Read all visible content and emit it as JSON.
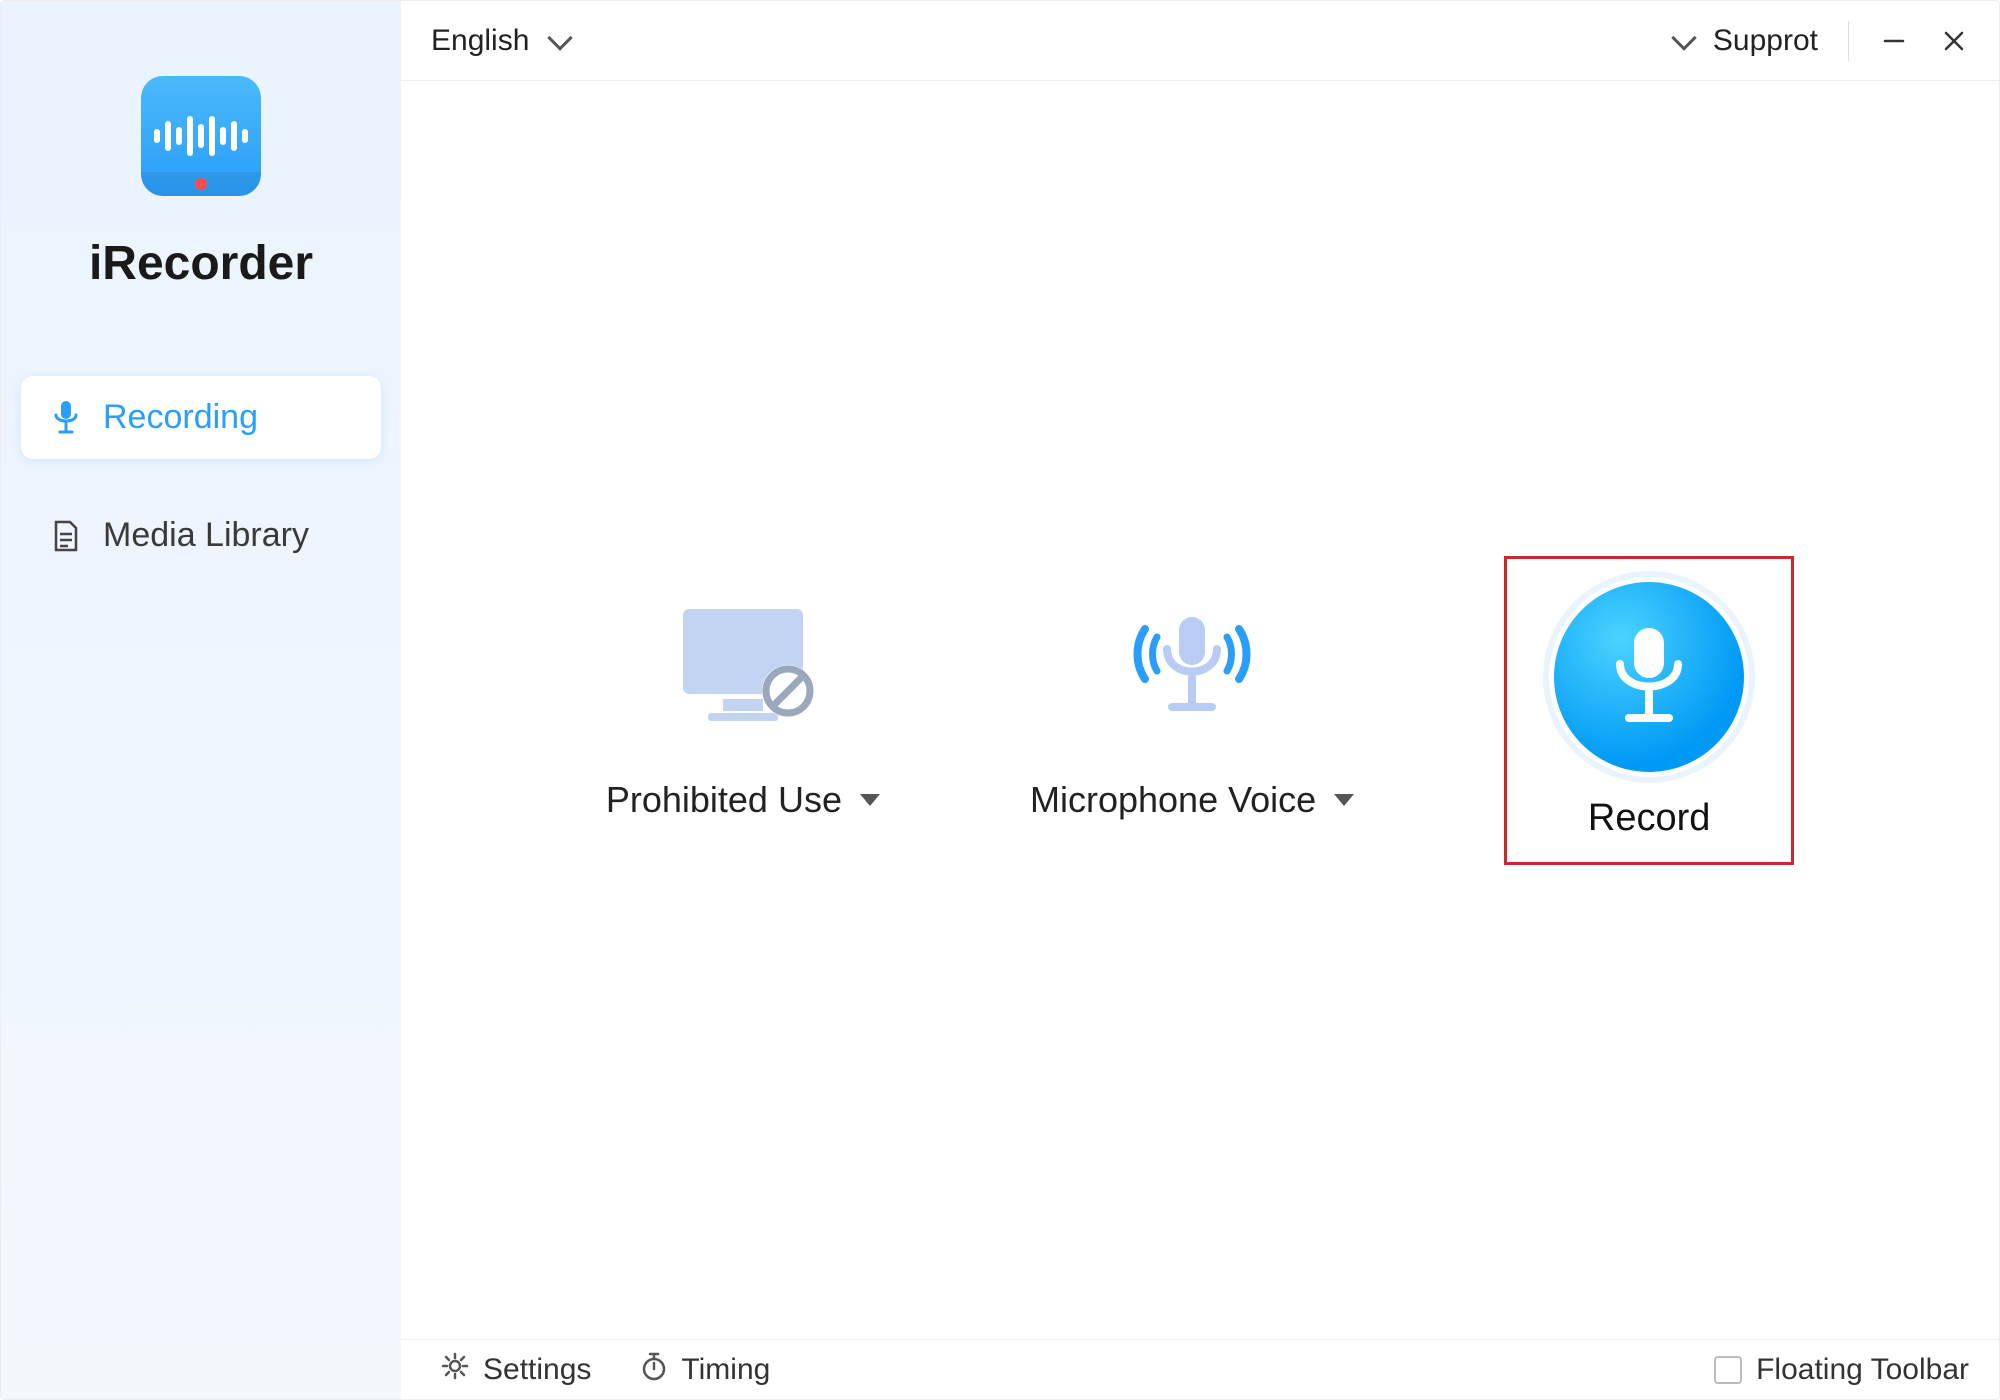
{
  "app": {
    "title": "iRecorder"
  },
  "sidebar": {
    "items": [
      {
        "label": "Recording",
        "icon": "mic-icon",
        "active": true
      },
      {
        "label": "Media Library",
        "icon": "document-icon",
        "active": false
      }
    ]
  },
  "topbar": {
    "language": "English",
    "support_label": "Supprot"
  },
  "options": {
    "system_sound": {
      "label": "Prohibited Use"
    },
    "microphone": {
      "label": "Microphone Voice"
    },
    "record": {
      "label": "Record"
    }
  },
  "footer": {
    "settings_label": "Settings",
    "timing_label": "Timing",
    "floating_toolbar_label": "Floating Toolbar",
    "floating_toolbar_checked": false
  },
  "colors": {
    "accent": "#2a9ef8",
    "highlight_border": "#c92a2a"
  }
}
